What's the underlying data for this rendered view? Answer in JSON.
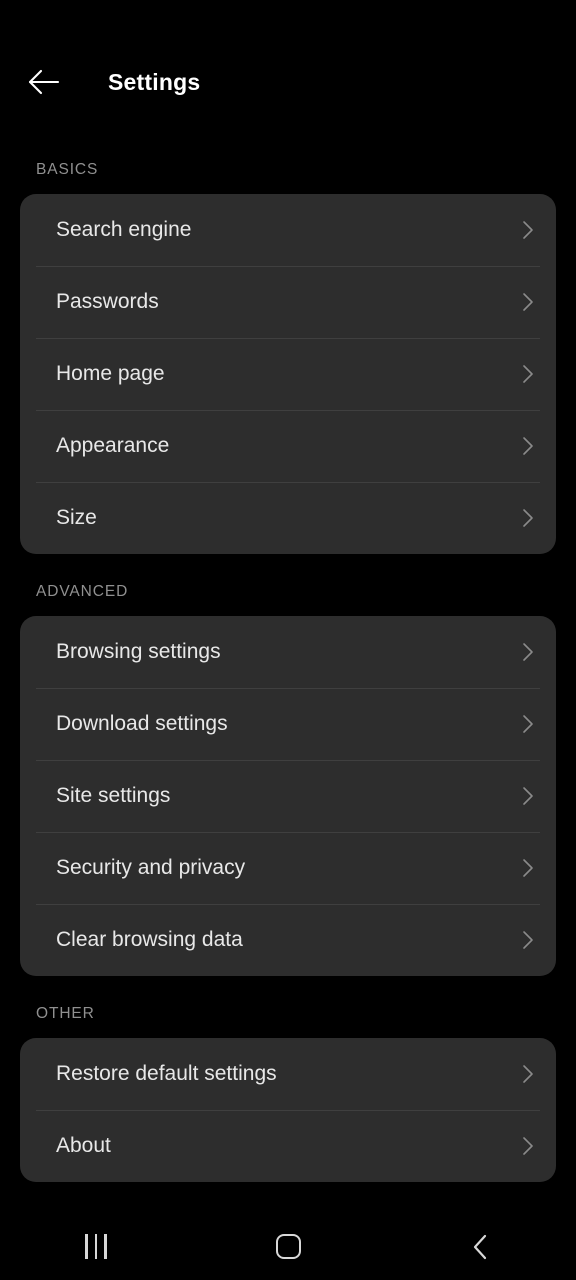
{
  "header": {
    "title": "Settings",
    "back_icon": "arrow-left-icon"
  },
  "sections": [
    {
      "label": "BASICS",
      "items": [
        {
          "label": "Search engine",
          "chevron": "chevron-right-icon"
        },
        {
          "label": "Passwords",
          "chevron": "chevron-right-icon"
        },
        {
          "label": "Home page",
          "chevron": "chevron-right-icon"
        },
        {
          "label": "Appearance",
          "chevron": "chevron-right-icon"
        },
        {
          "label": "Size",
          "chevron": "chevron-right-icon"
        }
      ]
    },
    {
      "label": "ADVANCED",
      "items": [
        {
          "label": "Browsing settings",
          "chevron": "chevron-right-icon"
        },
        {
          "label": "Download settings",
          "chevron": "chevron-right-icon"
        },
        {
          "label": "Site settings",
          "chevron": "chevron-right-icon"
        },
        {
          "label": "Security and privacy",
          "chevron": "chevron-right-icon"
        },
        {
          "label": "Clear browsing data",
          "chevron": "chevron-right-icon"
        }
      ]
    },
    {
      "label": "OTHER",
      "items": [
        {
          "label": "Restore default settings",
          "chevron": "chevron-right-icon"
        },
        {
          "label": "About",
          "chevron": "chevron-right-icon"
        }
      ]
    }
  ],
  "navbar": {
    "recents_icon": "recents-icon",
    "home_icon": "home-icon",
    "back_icon": "back-chevron-icon"
  },
  "colors": {
    "background": "#000000",
    "card": "#2d2d2d",
    "divider": "#3f3f3f",
    "primary_text": "#e8e8e8",
    "title_text": "#ffffff",
    "section_text": "#909090",
    "chevron": "#8a8a8a",
    "nav_icon": "#d8d8d8"
  }
}
